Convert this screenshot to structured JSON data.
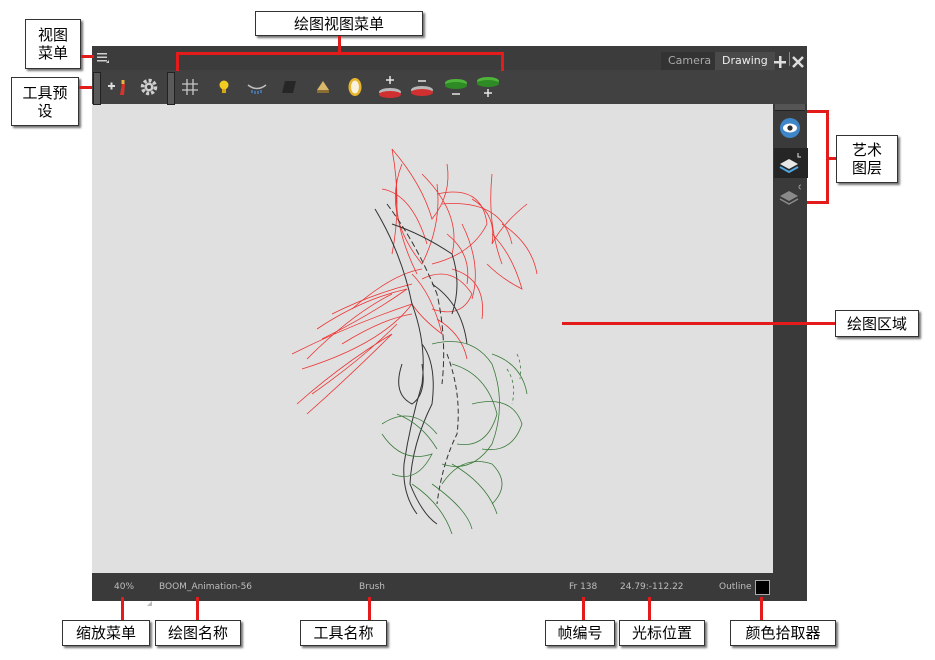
{
  "window": {
    "tabs": [
      {
        "label": "Camera",
        "active": false
      },
      {
        "label": "Drawing",
        "active": true
      }
    ],
    "add_icon": "plus-icon",
    "close_icon": "close-icon"
  },
  "toolbar": {
    "icons": [
      "hamburger-menu-icon",
      "tool-preset-icon",
      "gear-icon",
      "grid-icon",
      "bulb-icon",
      "onion-skin-icon",
      "shade-icon",
      "light-table-icon",
      "mirror-icon",
      "add-previous-icon",
      "remove-previous-icon",
      "remove-next-icon",
      "add-next-icon"
    ]
  },
  "status": {
    "zoom": "40%",
    "drawing_name": "BOOM_Animation-56",
    "tool_name": "Brush",
    "frame": "Fr 138",
    "coords": "24.79:-112.22",
    "outline": "Outline"
  },
  "callouts": {
    "view_menu": "视图\n菜单",
    "tool_presets": "工具预\n设",
    "drawing_view_menu": "绘图视图菜单",
    "art_layers": "艺术\n图层",
    "drawing_area": "绘图区域",
    "zoom_menu": "缩放菜单",
    "drawing_name": "绘图名称",
    "tool_name": "工具名称",
    "frame_number": "帧编号",
    "cursor_position": "光标位置",
    "color_picker": "颜色拾取器"
  },
  "colors": {
    "callout_line": "#e41b1b",
    "canvas": "#e0e0e0",
    "panel": "#3a3a3a"
  }
}
